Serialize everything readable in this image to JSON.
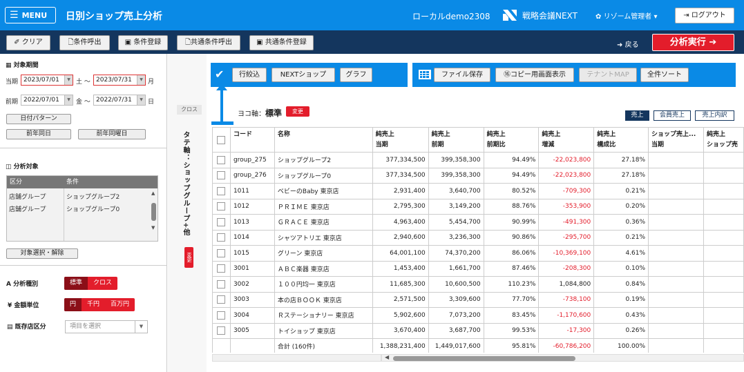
{
  "header": {
    "menu_label": "MENU",
    "title": "日別ショップ売上分析",
    "company": "ローカルdemo2308",
    "brand": "戦略会議NEXT",
    "user": "リゾーム管理者",
    "logout": "ログアウト"
  },
  "toolbar": {
    "clear": "クリア",
    "load_condition": "条件呼出",
    "save_condition": "条件登録",
    "load_shared": "共通条件呼出",
    "save_shared": "共通条件登録",
    "back": "戻る",
    "run": "分析実行"
  },
  "sidebar": {
    "period_title": "対象期間",
    "current_label": "当期",
    "current_from": "2023/07/01",
    "current_from_day": "土",
    "tilde": "～",
    "current_to": "2023/07/31",
    "current_to_day": "月",
    "prev_label": "前期",
    "prev_from": "2022/07/01",
    "prev_from_day": "金",
    "prev_to": "2022/07/31",
    "prev_to_day": "日",
    "date_pattern": "日付パターン",
    "prev_same_date": "前年同日",
    "prev_same_weekday": "前年同曜日",
    "target_title": "分析対象",
    "col_kubun": "区分",
    "col_condition": "条件",
    "targets": [
      {
        "kubun": "店舗グループ",
        "condition": "ショップグループ2"
      },
      {
        "kubun": "店舗グループ",
        "condition": "ショップグループ0"
      }
    ],
    "target_select": "対象選択・解除",
    "type_title": "分析種別",
    "type_options": [
      "標準",
      "クロス"
    ],
    "unit_title": "金額単位",
    "unit_options": [
      "円",
      "千円",
      "百万円"
    ],
    "existing_title": "既存店区分",
    "existing_placeholder": "項目を選択"
  },
  "vertical": {
    "cross": "クロス",
    "axis": "タテ軸：ショップグループ+他",
    "change": "変更"
  },
  "actions": {
    "row_filter": "行絞込",
    "next_shop": "NEXTショップ",
    "graph": "グラフ",
    "file_save": "ファイル保存",
    "copy_display": "⑯コピー用画面表示",
    "tenant_map": "テナントMAP",
    "sort_all": "全件ソート"
  },
  "axis": {
    "label": "ヨコ軸：",
    "value": "標準",
    "change": "変更"
  },
  "tags": [
    "売上",
    "会員売上",
    "売上内訳"
  ],
  "table": {
    "headers": [
      [
        "",
        ""
      ],
      [
        "コード",
        ""
      ],
      [
        "名称",
        ""
      ],
      [
        "純売上",
        "当期"
      ],
      [
        "純売上",
        "前期"
      ],
      [
        "純売上",
        "前期比"
      ],
      [
        "純売上",
        "増減"
      ],
      [
        "純売上",
        "構成比"
      ],
      [
        "ショップ売上...",
        "当期"
      ],
      [
        "純売上",
        "ショップ売"
      ]
    ],
    "rows": [
      [
        "group_275",
        "ショップグループ2",
        "377,334,500",
        "399,358,300",
        "94.49%",
        "-22,023,800",
        "27.18%"
      ],
      [
        "group_276",
        "ショップグループ0",
        "377,334,500",
        "399,358,300",
        "94.49%",
        "-22,023,800",
        "27.18%"
      ],
      [
        "1011",
        "ベビーのBaby 東京店",
        "2,931,400",
        "3,640,700",
        "80.52%",
        "-709,300",
        "0.21%"
      ],
      [
        "1012",
        "ＰＲＩＭＥ 東京店",
        "2,795,300",
        "3,149,200",
        "88.76%",
        "-353,900",
        "0.20%"
      ],
      [
        "1013",
        "ＧＲＡＣＥ 東京店",
        "4,963,400",
        "5,454,700",
        "90.99%",
        "-491,300",
        "0.36%"
      ],
      [
        "1014",
        "シャツアトリエ 東京店",
        "2,940,600",
        "3,236,300",
        "90.86%",
        "-295,700",
        "0.21%"
      ],
      [
        "1015",
        "グリーン 東京店",
        "64,001,100",
        "74,370,200",
        "86.06%",
        "-10,369,100",
        "4.61%"
      ],
      [
        "3001",
        "ＡＢＣ楽器 東京店",
        "1,453,400",
        "1,661,700",
        "87.46%",
        "-208,300",
        "0.10%"
      ],
      [
        "3002",
        "１００円均一 東京店",
        "11,685,300",
        "10,600,500",
        "110.23%",
        "1,084,800",
        "0.84%"
      ],
      [
        "3003",
        "本の店ＢＯＯＫ 東京店",
        "2,571,500",
        "3,309,600",
        "77.70%",
        "-738,100",
        "0.19%"
      ],
      [
        "3004",
        "Ｒステーショナリー 東京店",
        "5,902,600",
        "7,073,200",
        "83.45%",
        "-1,170,600",
        "0.43%"
      ],
      [
        "3005",
        "トイショップ 東京店",
        "3,670,400",
        "3,687,700",
        "99.53%",
        "-17,300",
        "0.26%"
      ]
    ],
    "total": [
      "",
      "合計 (160件)",
      "1,388,231,400",
      "1,449,017,600",
      "95.81%",
      "-60,786,200",
      "100.00%"
    ]
  }
}
